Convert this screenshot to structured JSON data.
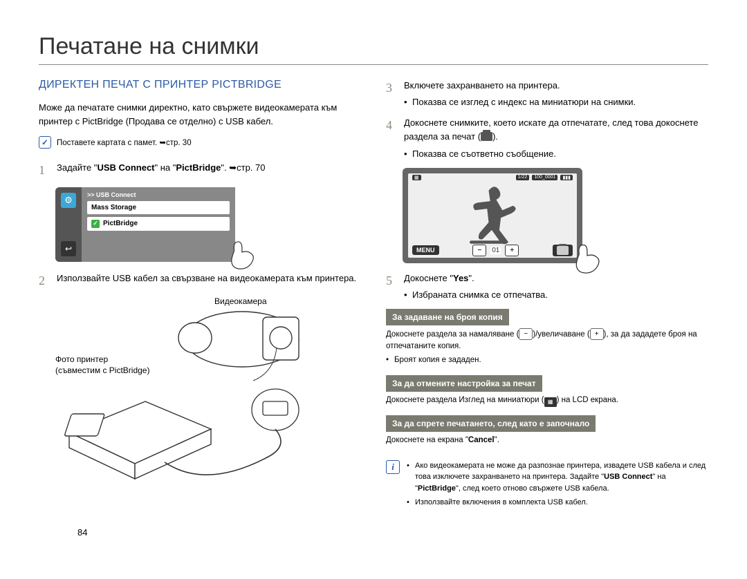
{
  "title": "Печатане на снимки",
  "section_heading": "ДИРЕКТЕН ПЕЧАТ С ПРИНТЕР PICTBRIDGE",
  "intro": "Може да печатате снимки директно, като свържете видеокамерата към принтер с PictBridge (Продава се отделно) с USB кабел.",
  "note_memory": "Поставете картата с памет. ➥стр. 30",
  "left_steps": {
    "1": {
      "text_prefix": "Задайте \"",
      "usb_connect": "USB Connect",
      "text_mid": "\" на \"",
      "pictbridge": "PictBridge",
      "text_suffix": "\". ➥стр. 70"
    },
    "2": {
      "text": "Използвайте USB кабел за свързване на видеокамерата към принтера."
    }
  },
  "usb_screen": {
    "title": ">> USB Connect",
    "item1": "Mass Storage",
    "item2": "PictBridge"
  },
  "illus_labels": {
    "camera": "Видеокамера",
    "printer_line1": "Фото принтер",
    "printer_line2": "(съвместим с PictBridge)"
  },
  "right_steps": {
    "3": {
      "text": "Включете захранването на принтера.",
      "bullet": "Показва се изглед с индекс на миниатюри на снимки."
    },
    "4": {
      "text_a": "Докоснете снимките, което искате да отпечатате, след това докоснете раздела за печат (",
      "text_b": ").",
      "bullet": "Показва се съответно съобщение."
    },
    "5": {
      "text_a": "Докоснете \"",
      "yes": "Yes",
      "text_b": "\".",
      "bullet": "Избраната снимка се отпечатва."
    }
  },
  "preview": {
    "counter": "1/22",
    "res": "100_0001",
    "menu": "MENU",
    "minus": "−",
    "count": "01",
    "plus": "+"
  },
  "tips": {
    "copies": {
      "head": "За задаване на броя копия",
      "body_a": "Докоснете раздела за намаляване (",
      "body_b": ")/увеличаване (",
      "body_c": "), за да зададете броя на отпечатаните копия.",
      "bullet": "Броят копия е зададен."
    },
    "cancel_setting": {
      "head": "За да отмените настройка за печат",
      "body_a": "Докоснете раздела Изглед на миниатюри (",
      "body_b": ") на LCD екрана."
    },
    "stop": {
      "head": "За да спрете печатането, след като е започнало",
      "body_a": "Докоснете на екрана \"",
      "cancel": "Cancel",
      "body_b": "\"."
    }
  },
  "bottom_notes": {
    "n1_a": "Ако видеокамерата не може да разпознае принтера, извадете USB кабела и след това изключете захранването на принтера. Задайте \"",
    "n1_usb": "USB Connect",
    "n1_b": "\" на \"",
    "n1_pb": "PictBridge",
    "n1_c": "\", след което отново свържете USB кабела.",
    "n2": "Използвайте включения в комплекта USB кабел."
  },
  "page_number": "84",
  "icons": {
    "check": "✓",
    "gear": "⚙",
    "back": "↩",
    "info": "i"
  },
  "minus": "−",
  "plus": "+"
}
